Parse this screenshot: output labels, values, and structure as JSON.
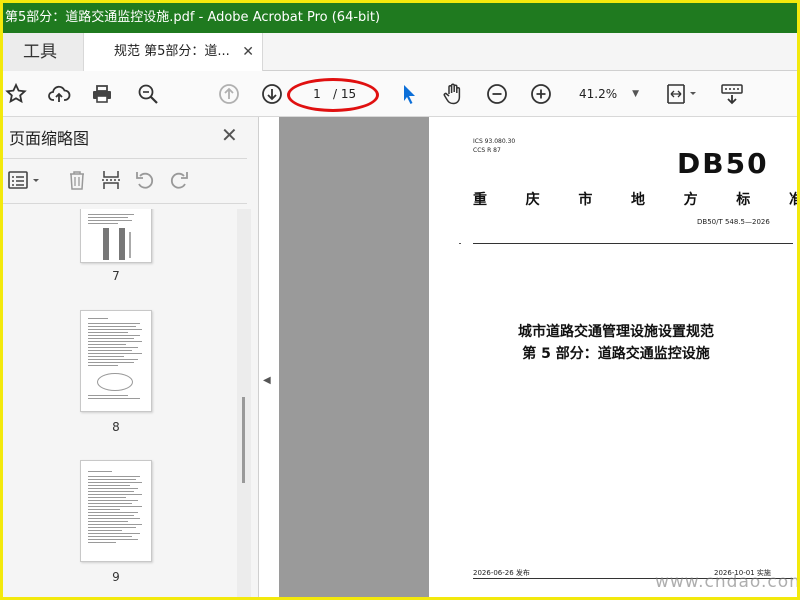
{
  "window": {
    "title": "第5部分：道路交通监控设施.pdf - Adobe Acrobat Pro (64-bit)"
  },
  "tabs": {
    "tools_label": "工具",
    "document_label": "规范 第5部分：道...",
    "close_glyph": "✕"
  },
  "toolbar": {
    "current_page": "1",
    "total_pages": "/ 15",
    "zoom": "41.2%",
    "icons": [
      "star-icon",
      "cloud-upload-icon",
      "printer-icon",
      "search-zoom-icon",
      "page-up-icon",
      "page-down-icon",
      "select-arrow-icon",
      "hand-tool-icon",
      "zoom-out-icon",
      "zoom-in-icon",
      "fit-page-icon",
      "keyboard-scroll-icon"
    ],
    "accent_color": "#0c6fd8",
    "highlight_color": "#e01010"
  },
  "sidepanel": {
    "title": "页面缩略图",
    "close_glyph": "✕",
    "thumbnails": [
      {
        "page": "7"
      },
      {
        "page": "8"
      },
      {
        "page": "9"
      }
    ]
  },
  "document": {
    "ics_line1": "ICS  93.080.30",
    "ics_line2": "CCS R 87",
    "db_mark": "DB50",
    "org_chars": [
      "重",
      "庆",
      "市",
      "地",
      "方",
      "标",
      "准"
    ],
    "std_number": "DB50/T 548.5—2026",
    "title_line1": "城市道路交通管理设施设置规范",
    "title_line2": "第 5 部分：道路交通监控设施",
    "publish_date": "2026-06-26 发布",
    "implement_date": "2026-10-01 实施"
  },
  "watermark": {
    "site": "www.cndao.com"
  }
}
